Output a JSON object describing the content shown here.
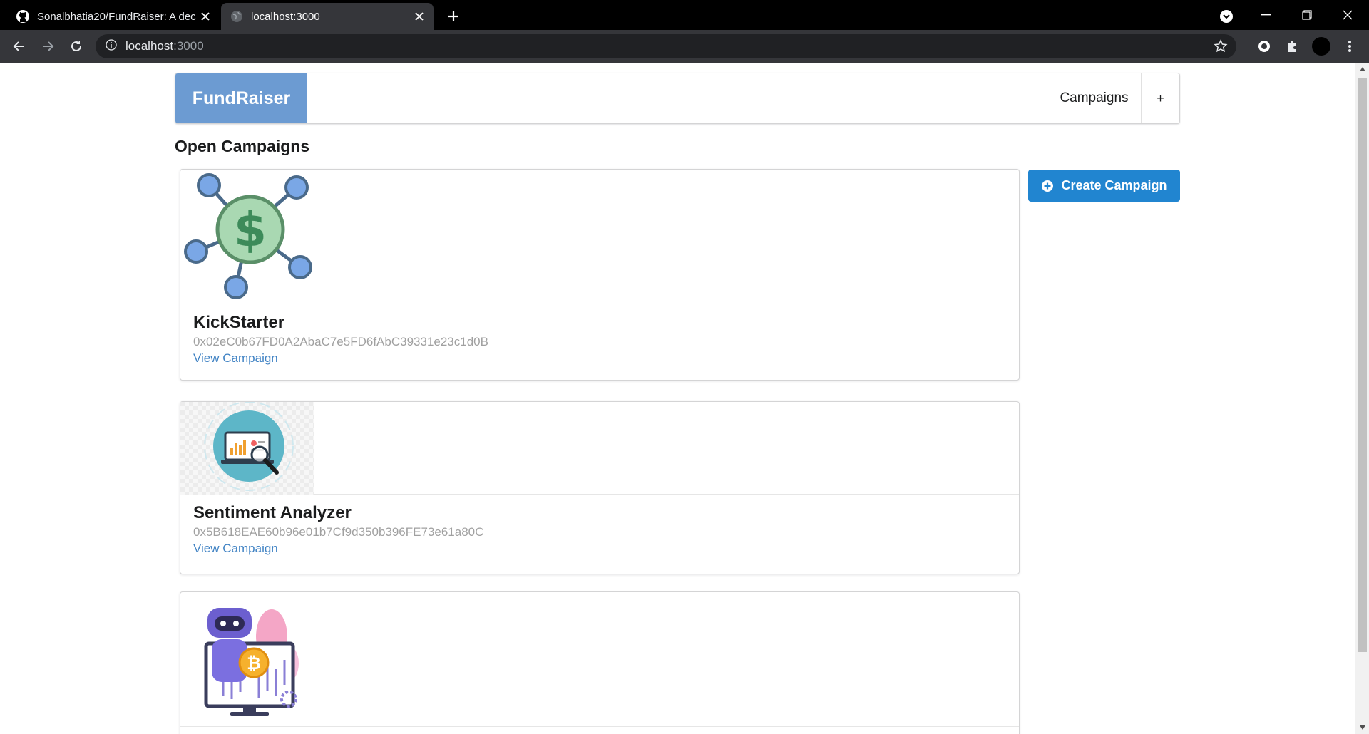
{
  "browser": {
    "tabs": [
      {
        "title": "Sonalbhatia20/FundRaiser: A dec",
        "active": false
      },
      {
        "title": "localhost:3000",
        "active": true
      }
    ],
    "url_host": "localhost",
    "url_port": ":3000"
  },
  "nav": {
    "brand": "FundRaiser",
    "campaigns_label": "Campaigns",
    "plus_label": "+"
  },
  "page": {
    "title": "Open Campaigns",
    "create_button": "Create Campaign"
  },
  "campaigns": [
    {
      "name": "KickStarter",
      "address": "0x02eC0b67FD0A2AbaC7e5FD6fAbC39331e23c1d0B",
      "link": "View Campaign",
      "image": "dollar-network-icon"
    },
    {
      "name": "Sentiment Analyzer",
      "address": "0x5B618EAE60b96e01b7Cf9d350b396FE73e61a80C",
      "link": "View Campaign",
      "image": "laptop-magnifier-icon"
    },
    {
      "name": "",
      "address": "",
      "link": "",
      "image": "robot-bitcoin-icon"
    }
  ],
  "colors": {
    "brand": "#6c9bd2",
    "primary_button": "#2185d0",
    "link": "#4183c4"
  }
}
